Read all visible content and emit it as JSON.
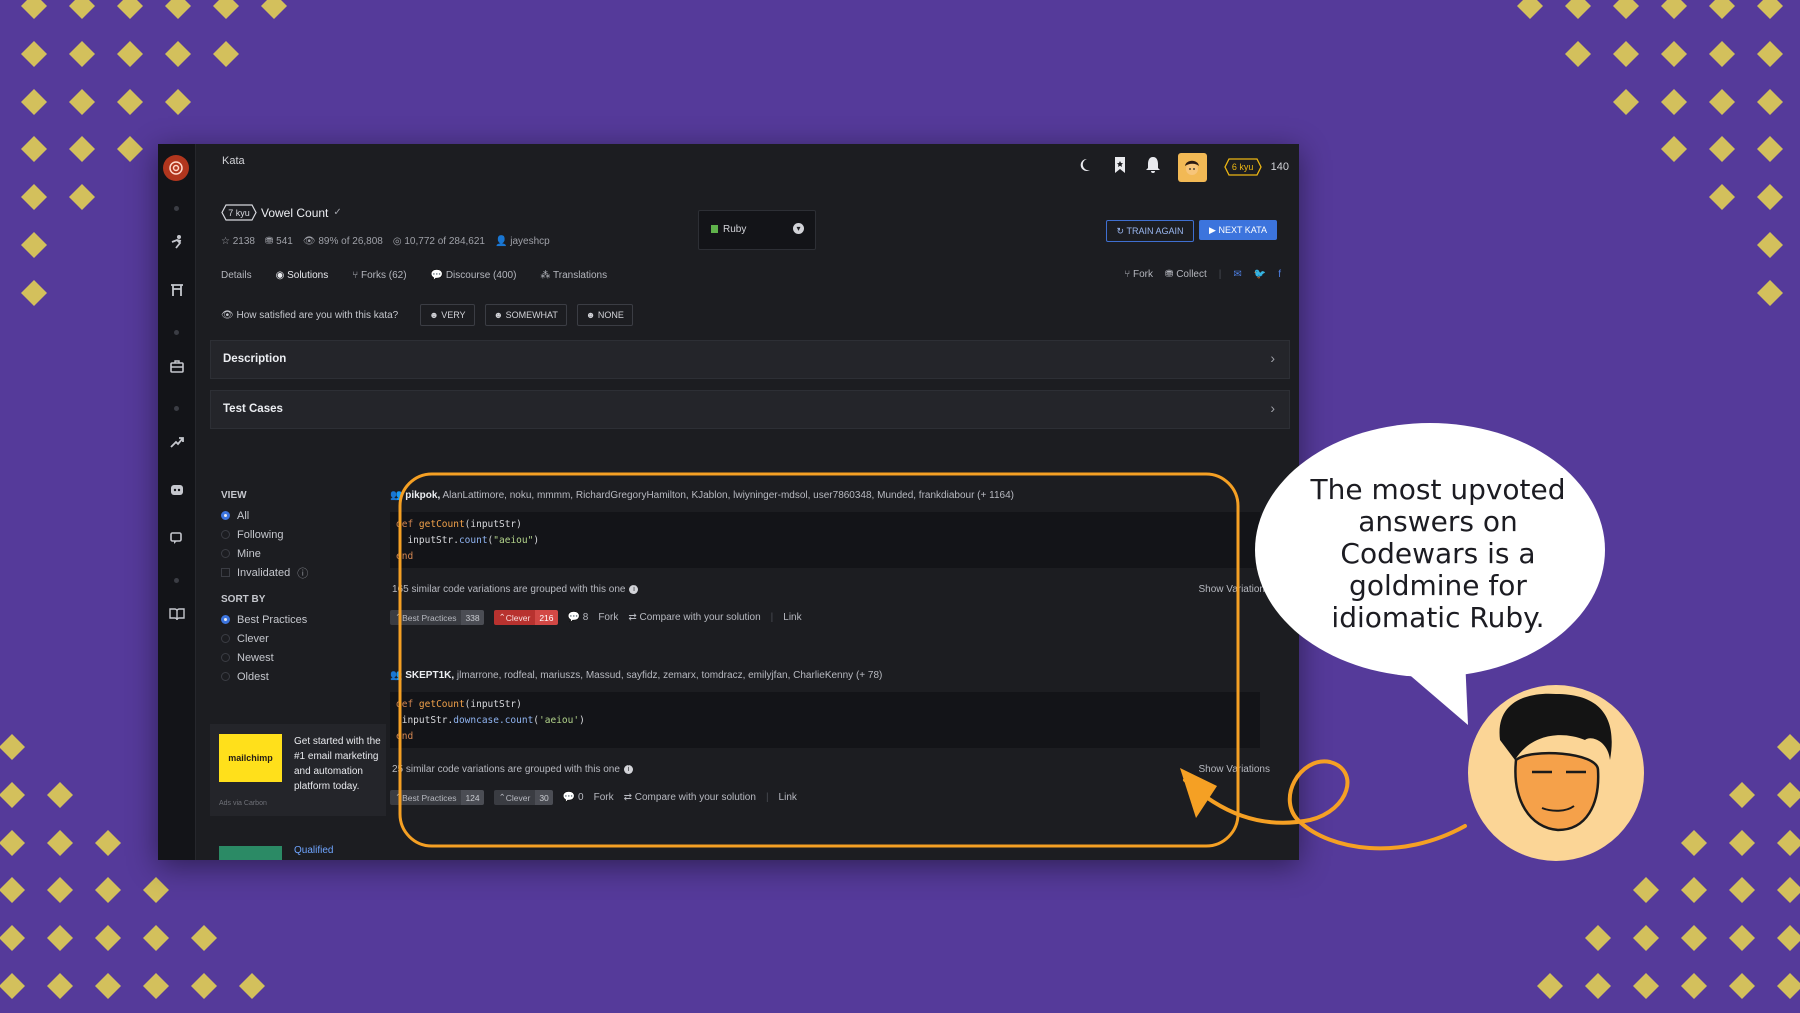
{
  "colors": {
    "background": "#553a9a",
    "diamond": "#d3c05c",
    "highlight_orange": "#f5a024",
    "accent_blue": "#3c74dd",
    "clever_red": "#b8322f",
    "rank_yellow": "#ecb613"
  },
  "topbar": {
    "breadcrumb": "Kata",
    "icons": [
      "moon-icon",
      "bookmark-icon",
      "bell-icon"
    ],
    "rank": "6 kyu",
    "honor": "140"
  },
  "sidebar": {
    "icons": [
      "codewars-logo",
      "practice-icon",
      "dojo-icon",
      "briefcase-icon",
      "leaderboard-icon",
      "discord-icon",
      "chat-icon",
      "docs-icon"
    ]
  },
  "kata": {
    "rank": "7 kyu",
    "title": "Vowel Count",
    "verified_mark": "✓",
    "stars": "2138",
    "collections": "541",
    "satisfaction": "89% of 26,808",
    "completed": "10,772 of 284,621",
    "author": "jayeshcp"
  },
  "language": {
    "selected": "Ruby"
  },
  "buttons": {
    "train_again": "TRAIN AGAIN",
    "next_kata": "NEXT KATA"
  },
  "tabs": [
    {
      "label": "Details"
    },
    {
      "label": "Solutions"
    },
    {
      "label": "Forks (62)"
    },
    {
      "label": "Discourse (400)"
    },
    {
      "label": "Translations"
    }
  ],
  "tab_actions": {
    "fork": "Fork",
    "collect": "Collect"
  },
  "satisfaction_poll": {
    "question": "How satisfied are you with this kata?",
    "options": [
      "VERY",
      "SOMEWHAT",
      "NONE"
    ]
  },
  "panels": {
    "description": "Description",
    "test_cases": "Test Cases"
  },
  "filters": {
    "view_heading": "VIEW",
    "view_options": [
      "All",
      "Following",
      "Mine"
    ],
    "view_selected": "All",
    "invalidated_label": "Invalidated",
    "sort_heading": "SORT BY",
    "sort_options": [
      "Best Practices",
      "Clever",
      "Newest",
      "Oldest"
    ],
    "sort_selected": "Best Practices"
  },
  "ads": {
    "mailchimp_logo": "mailchimp",
    "mailchimp_text": "Get started with the #1 email marketing and automation platform today.",
    "via": "Ads via Carbon",
    "second_ad_title": "Qualified"
  },
  "solutions": [
    {
      "lead_user": "pikpok,",
      "other_users": "AlanLattimore, noku, mmmm, RichardGregoryHamilton, KJablon, lwiyninger-mdsol, user7860348, Munded, frankdiabour (+ 1164)",
      "code": {
        "def": "def",
        "fn": "getCount",
        "param": "(inputStr)",
        "receiver": "inputStr.",
        "method": "count",
        "arg": "\"aeiou\"",
        "end": "end"
      },
      "variations_note": "165 similar code variations are grouped with this one",
      "show_variations": "Show Variations",
      "best_practices_label": "Best Practices",
      "best_practices_count": "338",
      "clever_label": "Clever",
      "clever_count": "216",
      "comments": "8",
      "fork": "Fork",
      "compare": "Compare with your solution",
      "link": "Link"
    },
    {
      "lead_user": "SKEPT1K,",
      "other_users": "jlmarrone, rodfeal, mariuszs, Massud, sayfidz, zemarx, tomdracz, emilyjfan, CharlieKenny (+ 78)",
      "code": {
        "def": "def",
        "fn": "getCount",
        "param": "(inputStr)",
        "receiver": "inputStr.",
        "method": "downcase.count",
        "arg": "'aeiou'",
        "end": "end"
      },
      "variations_note": "25 similar code variations are grouped with this one",
      "show_variations": "Show Variations",
      "best_practices_label": "Best Practices",
      "best_practices_count": "124",
      "clever_label": "Clever",
      "clever_count": "30",
      "comments": "0",
      "fork": "Fork",
      "compare": "Compare with your solution",
      "link": "Link"
    }
  ],
  "annotation": {
    "bubble_text": "The most upvoted answers on Codewars is a goldmine for idiomatic Ruby."
  }
}
